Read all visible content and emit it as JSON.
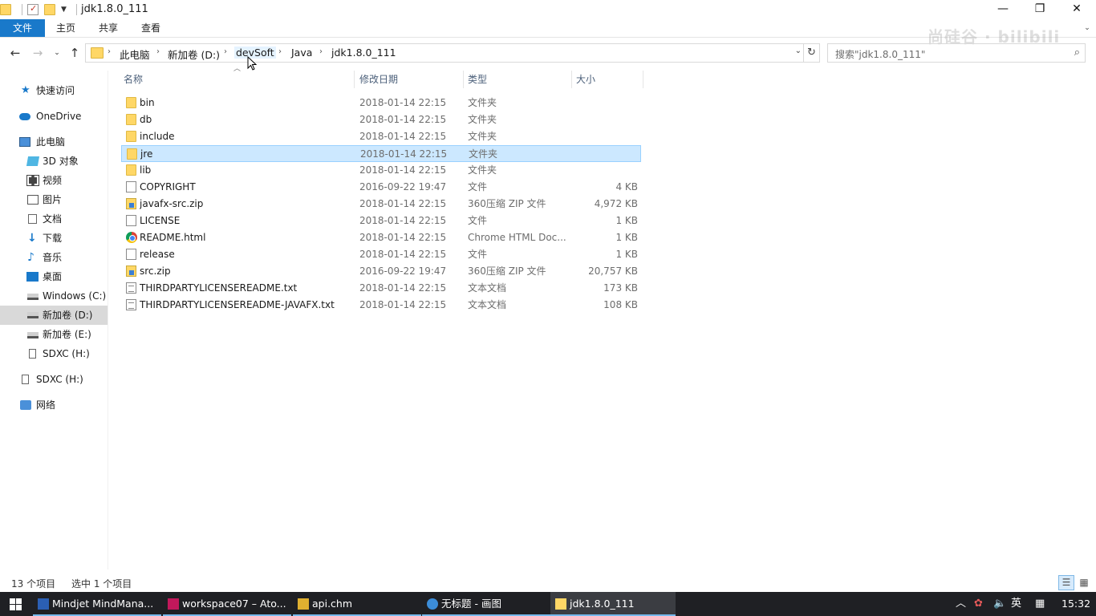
{
  "window": {
    "title": "jdk1.8.0_111"
  },
  "ribbon": {
    "file_tab": "文件",
    "tabs": [
      "主页",
      "共享",
      "查看"
    ]
  },
  "address": {
    "crumbs": [
      "此电脑",
      "新加卷 (D:)",
      "devSoft",
      "Java",
      "jdk1.8.0_111"
    ]
  },
  "search": {
    "placeholder": "搜索\"jdk1.8.0_111\""
  },
  "sidebar": {
    "items": [
      {
        "label": "快速访问",
        "icon": "star-icon"
      },
      {
        "label": "OneDrive",
        "icon": "cloud-icon"
      },
      {
        "label": "此电脑",
        "icon": "computer-icon"
      },
      {
        "label": "3D 对象",
        "icon": "cube-icon"
      },
      {
        "label": "视频",
        "icon": "video-icon"
      },
      {
        "label": "图片",
        "icon": "picture-icon"
      },
      {
        "label": "文档",
        "icon": "document-icon"
      },
      {
        "label": "下载",
        "icon": "download-icon"
      },
      {
        "label": "音乐",
        "icon": "music-icon"
      },
      {
        "label": "桌面",
        "icon": "desktop-icon"
      },
      {
        "label": "Windows (C:)",
        "icon": "drive-icon"
      },
      {
        "label": "新加卷 (D:)",
        "icon": "drive-icon",
        "selected": true
      },
      {
        "label": "新加卷 (E:)",
        "icon": "drive-icon"
      },
      {
        "label": "SDXC (H:)",
        "icon": "sd-card-icon"
      },
      {
        "label": "SDXC (H:)",
        "icon": "sd-card-icon"
      },
      {
        "label": "网络",
        "icon": "network-icon"
      }
    ]
  },
  "columns": {
    "name": "名称",
    "date": "修改日期",
    "type": "类型",
    "size": "大小"
  },
  "files": [
    {
      "name": "bin",
      "date": "2018-01-14 22:15",
      "type": "文件夹",
      "size": "",
      "icon": "folder"
    },
    {
      "name": "db",
      "date": "2018-01-14 22:15",
      "type": "文件夹",
      "size": "",
      "icon": "folder"
    },
    {
      "name": "include",
      "date": "2018-01-14 22:15",
      "type": "文件夹",
      "size": "",
      "icon": "folder"
    },
    {
      "name": "jre",
      "date": "2018-01-14 22:15",
      "type": "文件夹",
      "size": "",
      "icon": "folder",
      "selected": true
    },
    {
      "name": "lib",
      "date": "2018-01-14 22:15",
      "type": "文件夹",
      "size": "",
      "icon": "folder"
    },
    {
      "name": "COPYRIGHT",
      "date": "2016-09-22 19:47",
      "type": "文件",
      "size": "4 KB",
      "icon": "file"
    },
    {
      "name": "javafx-src.zip",
      "date": "2018-01-14 22:15",
      "type": "360压缩 ZIP 文件",
      "size": "4,972 KB",
      "icon": "zip"
    },
    {
      "name": "LICENSE",
      "date": "2018-01-14 22:15",
      "type": "文件",
      "size": "1 KB",
      "icon": "file"
    },
    {
      "name": "README.html",
      "date": "2018-01-14 22:15",
      "type": "Chrome HTML Doc...",
      "size": "1 KB",
      "icon": "html"
    },
    {
      "name": "release",
      "date": "2018-01-14 22:15",
      "type": "文件",
      "size": "1 KB",
      "icon": "file"
    },
    {
      "name": "src.zip",
      "date": "2016-09-22 19:47",
      "type": "360压缩 ZIP 文件",
      "size": "20,757 KB",
      "icon": "zip"
    },
    {
      "name": "THIRDPARTYLICENSEREADME.txt",
      "date": "2018-01-14 22:15",
      "type": "文本文档",
      "size": "173 KB",
      "icon": "txt"
    },
    {
      "name": "THIRDPARTYLICENSEREADME-JAVAFX.txt",
      "date": "2018-01-14 22:15",
      "type": "文本文档",
      "size": "108 KB",
      "icon": "txt"
    }
  ],
  "status": {
    "count": "13 个项目",
    "selected": "选中 1 个项目"
  },
  "taskbar": {
    "apps": [
      {
        "label": "Mindjet MindMana...",
        "icon": "mindjet-icon",
        "color": "#2b5fb4"
      },
      {
        "label": "workspace07 – Ato...",
        "icon": "intellij-icon",
        "color": "#c2185b"
      },
      {
        "label": "api.chm",
        "icon": "help-file-icon",
        "color": "#e0b030"
      },
      {
        "label": "无标题 - 画图",
        "icon": "paint-icon",
        "color": "#3c8dd9"
      },
      {
        "label": "jdk1.8.0_111",
        "icon": "folder-icon",
        "color": "#ffd766",
        "active": true
      }
    ],
    "ime": "英",
    "clock": "15:32"
  }
}
